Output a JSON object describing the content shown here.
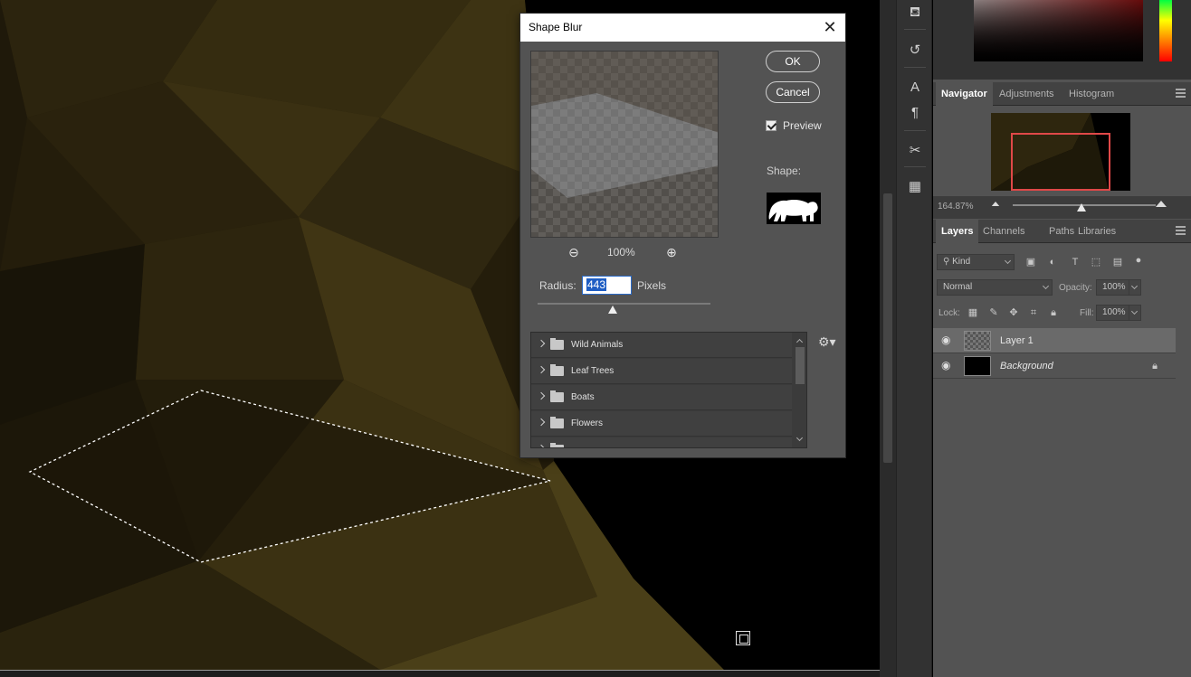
{
  "dialog": {
    "title": "Shape Blur",
    "ok_label": "OK",
    "cancel_label": "Cancel",
    "preview_label": "Preview",
    "preview_checked": true,
    "zoom_level": "100%",
    "shape_label": "Shape:",
    "radius_label": "Radius:",
    "radius_value": "443",
    "radius_unit": "Pixels",
    "shape_sets": [
      {
        "label": "Wild Animals"
      },
      {
        "label": "Leaf Trees"
      },
      {
        "label": "Boats"
      },
      {
        "label": "Flowers"
      }
    ]
  },
  "navigator": {
    "tabs": [
      "Navigator",
      "Adjustments",
      "Histogram"
    ],
    "active_tab": "Navigator",
    "zoom_percent": "164.87%"
  },
  "layers_panel": {
    "tabs": [
      "Layers",
      "Channels",
      "Paths",
      "Libraries"
    ],
    "active_tab": "Layers",
    "filter_kind": "Kind",
    "blend_mode": "Normal",
    "opacity_label": "Opacity:",
    "opacity_value": "100%",
    "lock_label": "Lock:",
    "fill_label": "Fill:",
    "fill_value": "100%",
    "layers": [
      {
        "name": "Layer 1",
        "selected": true
      },
      {
        "name": "Background",
        "selected": false,
        "locked": true
      }
    ]
  },
  "colors": {
    "accent_blue": "#1f5ec4",
    "nav_box": "#e04848",
    "canvas_gold": "#4a3f18"
  },
  "icons": {
    "tools": [
      "stamp-icon",
      "history-brush-icon",
      "type-tool-icon",
      "paragraph-icon",
      "scissors-icon",
      "grid-icon"
    ]
  }
}
